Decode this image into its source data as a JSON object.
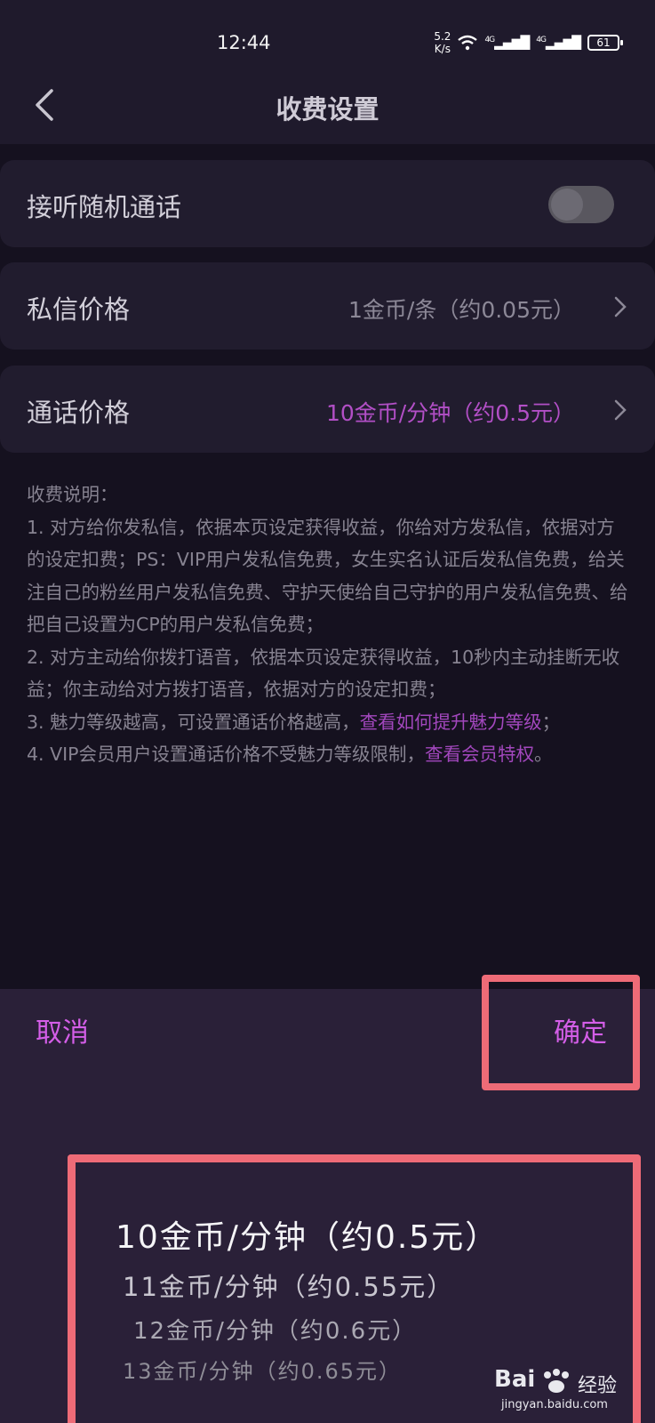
{
  "status_bar": {
    "time": "12:44",
    "net_speed_top": "5.2",
    "net_speed_bottom": "K/s",
    "signal_1": "4G",
    "signal_2": "4G",
    "battery": "61"
  },
  "header": {
    "title": "收费设置",
    "back_icon": "chevron-left-icon"
  },
  "settings": {
    "random_call": {
      "label": "接听随机通话",
      "enabled": false
    },
    "message_price": {
      "label": "私信价格",
      "value": "1金币/条（约0.05元）"
    },
    "call_price": {
      "label": "通话价格",
      "value": "10金币/分钟（约0.5元）"
    }
  },
  "description": {
    "title": "收费说明：",
    "item1": "1. 对方给你发私信，依据本页设定获得收益，你给对方发私信，依据对方的设定扣费；PS：VIP用户发私信免费，女生实名认证后发私信免费，给关注自己的粉丝用户发私信免费、守护天使给自己守护的用户发私信免费、给把自己设置为CP的用户发私信免费；",
    "item2": "2. 对方主动给你拨打语音，依据本页设定获得收益，10秒内主动挂断无收益；你主动给对方拨打语音，依据对方的设定扣费；",
    "item3_text": "3. 魅力等级越高，可设置通话价格越高，",
    "item3_link": "查看如何提升魅力等级",
    "item3_end": "；",
    "item4_text": "4. VIP会员用户设置通话价格不受魅力等级限制，",
    "item4_link": "查看会员特权",
    "item4_end": "。"
  },
  "picker_sheet": {
    "cancel_label": "取消",
    "confirm_label": "确定",
    "options": [
      "10金币/分钟（约0.5元）",
      "11金币/分钟（约0.55元）",
      "12金币/分钟（约0.6元）",
      "13金币/分钟（约0.65元）"
    ],
    "selected_index": 0
  },
  "watermark": {
    "brand": "Bai",
    "brand_suffix": "经验",
    "url": "jingyan.baidu.com"
  },
  "colors": {
    "accent": "#d45ee8",
    "link": "#a247bd",
    "highlight_box": "#ee6b77"
  }
}
